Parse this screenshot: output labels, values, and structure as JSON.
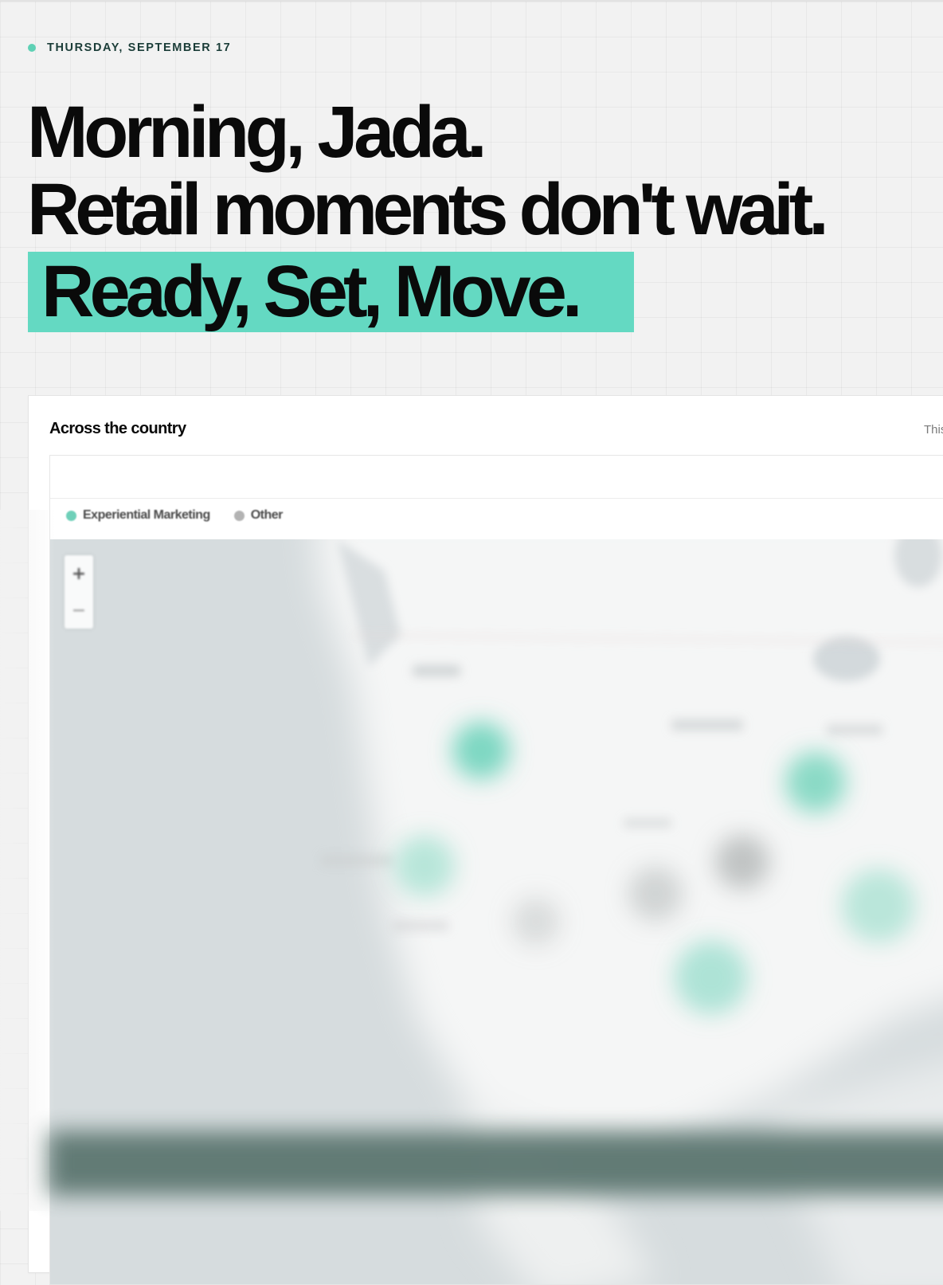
{
  "header": {
    "date": "THURSDAY, SEPTEMBER 17",
    "greeting": "Morning, Jada.",
    "tagline": "Retail moments don't wait.",
    "highlight": "Ready, Set, Move."
  },
  "panel": {
    "title": "Across the country",
    "range_label": "This"
  },
  "map": {
    "legend": [
      {
        "label": "Experiential Marketing",
        "color": "#6fd0b9"
      },
      {
        "label": "Other",
        "color": "#b3b3b3"
      }
    ],
    "zoom_in_label": "+",
    "zoom_out_label": "−"
  },
  "colors": {
    "accent": "#64d9c2",
    "background": "#f2f2f2",
    "map_water": "#d4dadc",
    "map_land": "#f4f5f5"
  }
}
